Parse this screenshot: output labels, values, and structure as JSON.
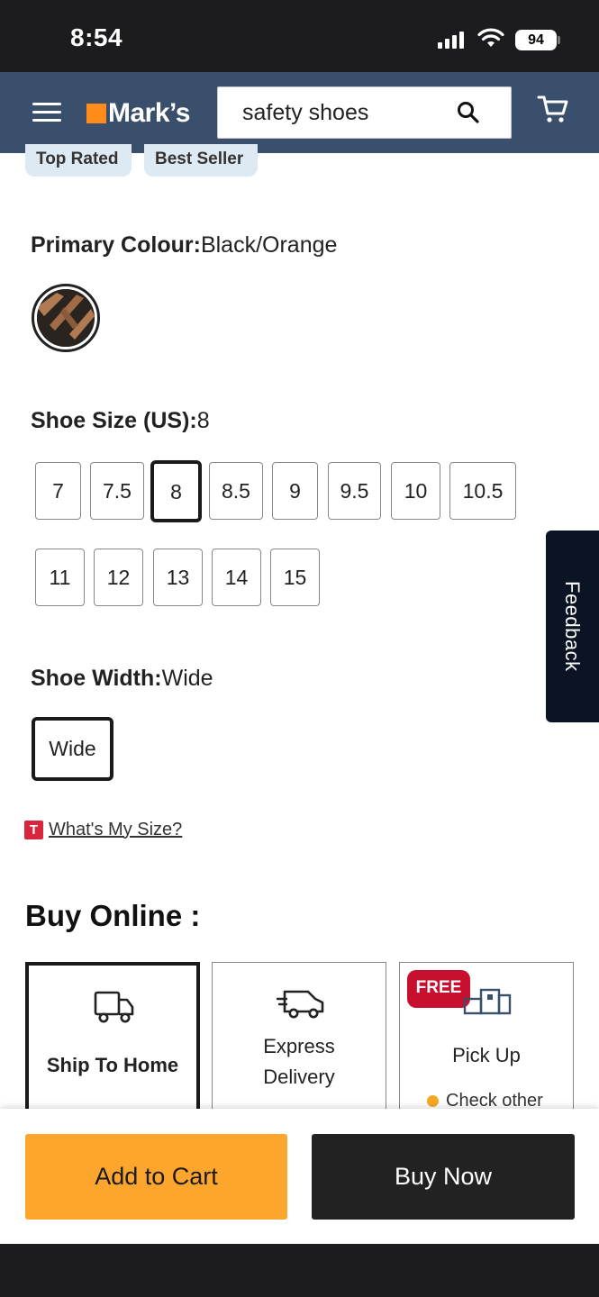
{
  "status_bar": {
    "time": "8:54",
    "battery": "94"
  },
  "header": {
    "logo": "Mark’s",
    "search_value": "safety shoes"
  },
  "tags": [
    "Top Rated",
    "Best Seller"
  ],
  "colour": {
    "label": "Primary Colour:",
    "value": "Black/Orange"
  },
  "size": {
    "label": "Shoe Size (US):",
    "value": "8",
    "options": [
      "7",
      "7.5",
      "8",
      "8.5",
      "9",
      "9.5",
      "10",
      "10.5",
      "11",
      "12",
      "13",
      "14",
      "15"
    ]
  },
  "width": {
    "label": "Shoe Width:",
    "value": "Wide",
    "options": [
      "Wide"
    ]
  },
  "size_link": {
    "badge": "T",
    "label": "What's My Size?"
  },
  "feedback": "Feedback",
  "buy_online": {
    "title": "Buy Online :",
    "options": {
      "ship": "Ship To Home",
      "express_line1": "Express",
      "express_line2": "Delivery",
      "pickup_badge": "FREE",
      "pickup": "Pick Up",
      "pickup_note": "Check other"
    }
  },
  "actions": {
    "add_to_cart": "Add to Cart",
    "buy_now": "Buy Now"
  },
  "colors": {
    "header": "#3a4f6b",
    "accent": "#fca62d",
    "brand_orange": "#ff8c1a",
    "free_badge": "#c8102e"
  }
}
